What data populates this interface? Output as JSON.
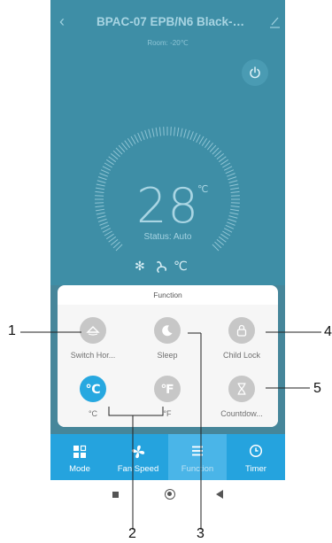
{
  "header": {
    "title": "BPAC-07 EPB/N6 Black-vd...",
    "room": "Room: -20℃",
    "back_icon": "back-chevron-icon",
    "edit_icon": "edit-pencil-icon",
    "power_icon": "power-icon"
  },
  "display": {
    "temperature": "28",
    "unit": "℃",
    "status": "Status: Auto",
    "mode_icons": [
      "snowflake-icon",
      "fan-icon",
      "celsius-icon"
    ],
    "celsius_glyph": "℃"
  },
  "function_panel": {
    "title": "Function",
    "items": [
      {
        "label": "Switch Hor...",
        "icon": "swing-icon",
        "glyph": "",
        "active": false
      },
      {
        "label": "Sleep",
        "icon": "moon-icon",
        "glyph": "",
        "active": false
      },
      {
        "label": "Child Lock",
        "icon": "lock-icon",
        "glyph": "",
        "active": false
      },
      {
        "label": "°C",
        "icon": "celsius-icon",
        "glyph": "℃",
        "active": true
      },
      {
        "label": "°F",
        "icon": "fahrenheit-icon",
        "glyph": "℉",
        "active": false
      },
      {
        "label": "Countdow...",
        "icon": "hourglass-icon",
        "glyph": "",
        "active": false
      }
    ]
  },
  "tabs": [
    {
      "label": "Mode",
      "icon": "mode-grid-icon",
      "selected": false
    },
    {
      "label": "Fan Speed",
      "icon": "fan-icon",
      "selected": false
    },
    {
      "label": "Function",
      "icon": "menu-lines-icon",
      "selected": true
    },
    {
      "label": "Timer",
      "icon": "clock-icon",
      "selected": false
    }
  ],
  "callouts": [
    "1",
    "2",
    "3",
    "4",
    "5"
  ],
  "colors": {
    "app_background": "#3e8ea6",
    "accent_blue": "#27a8e0",
    "tab_bar": "#25a3de",
    "inactive_circle": "#c7c7c7"
  }
}
